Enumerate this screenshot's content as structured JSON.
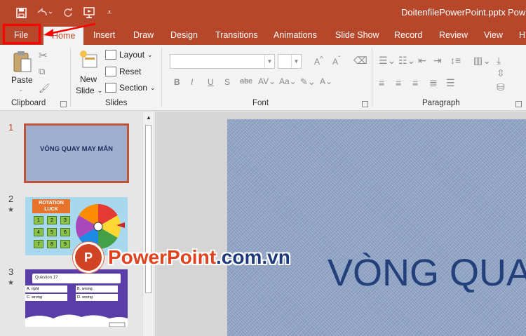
{
  "window": {
    "document_title": "DoitenfilePowerPoint.pptx",
    "app_name_partial": "Pow"
  },
  "quick_access": {
    "more_glyph": "⩡"
  },
  "tabs": [
    {
      "label": "File"
    },
    {
      "label": "Home"
    },
    {
      "label": "Insert"
    },
    {
      "label": "Draw"
    },
    {
      "label": "Design"
    },
    {
      "label": "Transitions"
    },
    {
      "label": "Animations"
    },
    {
      "label": "Slide Show"
    },
    {
      "label": "Record"
    },
    {
      "label": "Review"
    },
    {
      "label": "View"
    },
    {
      "label": "H"
    }
  ],
  "ribbon": {
    "clipboard": {
      "label": "Clipboard",
      "paste_label": "Paste"
    },
    "slides": {
      "label": "Slides",
      "new_slide_line1": "New",
      "new_slide_line2": "Slide",
      "layout": "Layout",
      "reset": "Reset",
      "section": "Section"
    },
    "font": {
      "label": "Font",
      "bold": "B",
      "italic": "I",
      "underline": "U",
      "shadow": "S",
      "strike": "abc"
    },
    "paragraph": {
      "label": "Paragraph"
    }
  },
  "slides": [
    {
      "number": "1",
      "title": "VÒNG QUAY MAY MẮN"
    },
    {
      "number": "2",
      "title": "ROTATION LUCK",
      "grid": [
        "1",
        "2",
        "3",
        "4",
        "5",
        "6",
        "7",
        "8",
        "9"
      ]
    },
    {
      "number": "3",
      "question": "Question 1?",
      "options": [
        "A. right",
        "B. wrong",
        "C. wrong",
        "D. wrong"
      ]
    }
  ],
  "main_slide": {
    "title": "VÒNG QUA"
  },
  "watermark": {
    "brand": "PowerPoint",
    "domain": ".com.vn",
    "logo_letter": "P"
  },
  "colors": {
    "accent": "#b7472a",
    "highlight": "#ff0000",
    "slide_title": "#23407a"
  }
}
